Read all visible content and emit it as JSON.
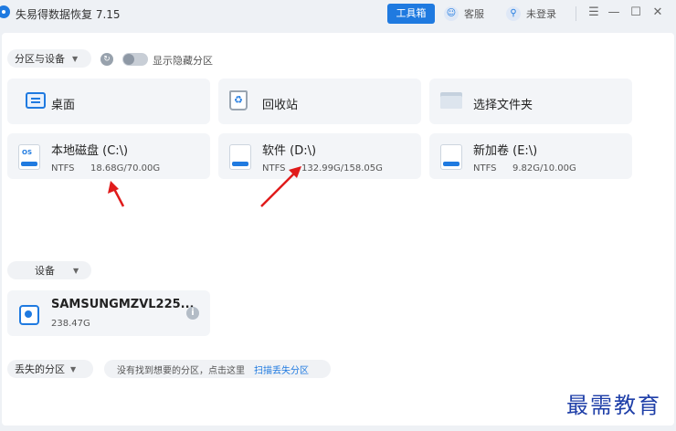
{
  "app": {
    "title": "失易得数据恢复 7.15"
  },
  "titlebar": {
    "toolbox_label": "工具箱",
    "service_label": "客服",
    "login_label": "未登录"
  },
  "partitions": {
    "filter_label": "分区与设备",
    "show_hidden_label": "显示隐藏分区",
    "locations": [
      {
        "label": "桌面",
        "icon": "desktop-icon"
      },
      {
        "label": "回收站",
        "icon": "recycle-bin-icon"
      },
      {
        "label": "选择文件夹",
        "icon": "folder-icon"
      }
    ],
    "drives": [
      {
        "label": "本地磁盘 (C:\\)",
        "fs": "NTFS",
        "size": "18.68G/70.00G",
        "badge": "OS"
      },
      {
        "label": "软件 (D:\\)",
        "fs": "NTFS",
        "size": "132.99G/158.05G"
      },
      {
        "label": "新加卷 (E:\\)",
        "fs": "NTFS",
        "size": "9.82G/10.00G"
      }
    ]
  },
  "devices": {
    "filter_label": "设备",
    "items": [
      {
        "name": "SAMSUNGMZVL225...",
        "size": "238.47G"
      }
    ]
  },
  "lost": {
    "filter_label": "丢失的分区",
    "hint_text": "没有找到想要的分区，点击这里",
    "scan_link": "扫描丢失分区"
  },
  "watermark": "最需教育",
  "colors": {
    "accent": "#1f7ae0",
    "arrow": "#e01b1b"
  }
}
